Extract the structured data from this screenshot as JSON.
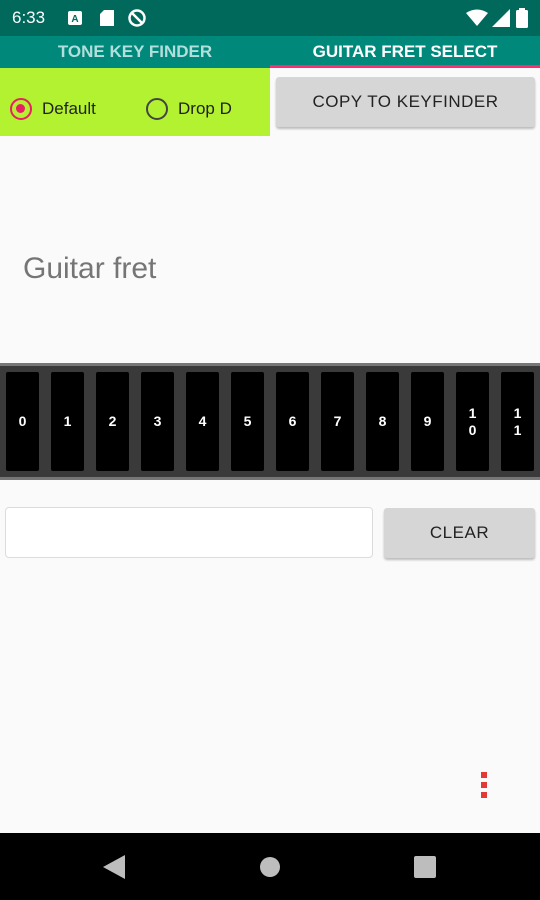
{
  "status_bar": {
    "time": "6:33",
    "icons": [
      "a-icon",
      "sd-card-icon",
      "no-disturb-icon",
      "wifi-icon",
      "signal-icon",
      "battery-icon"
    ]
  },
  "tabs": [
    {
      "label": "TONE KEY FINDER",
      "active": false
    },
    {
      "label": "GUITAR FRET SELECT",
      "active": true
    }
  ],
  "tuning": {
    "options": [
      {
        "label": "Default",
        "selected": true
      },
      {
        "label": "Drop D",
        "selected": false
      }
    ]
  },
  "copy_button": "COPY TO KEYFINDER",
  "title": "Guitar fret",
  "frets": [
    "0",
    "1",
    "2",
    "3",
    "4",
    "5",
    "6",
    "7",
    "8",
    "9",
    "10",
    "11"
  ],
  "input": {
    "value": "",
    "placeholder": ""
  },
  "clear_button": "CLEAR",
  "colors": {
    "status_bar": "#00695c",
    "tab_bar": "#00897b",
    "accent": "#e91e63",
    "radio_panel": "#b2f230",
    "menu_dots": "#e53935"
  }
}
